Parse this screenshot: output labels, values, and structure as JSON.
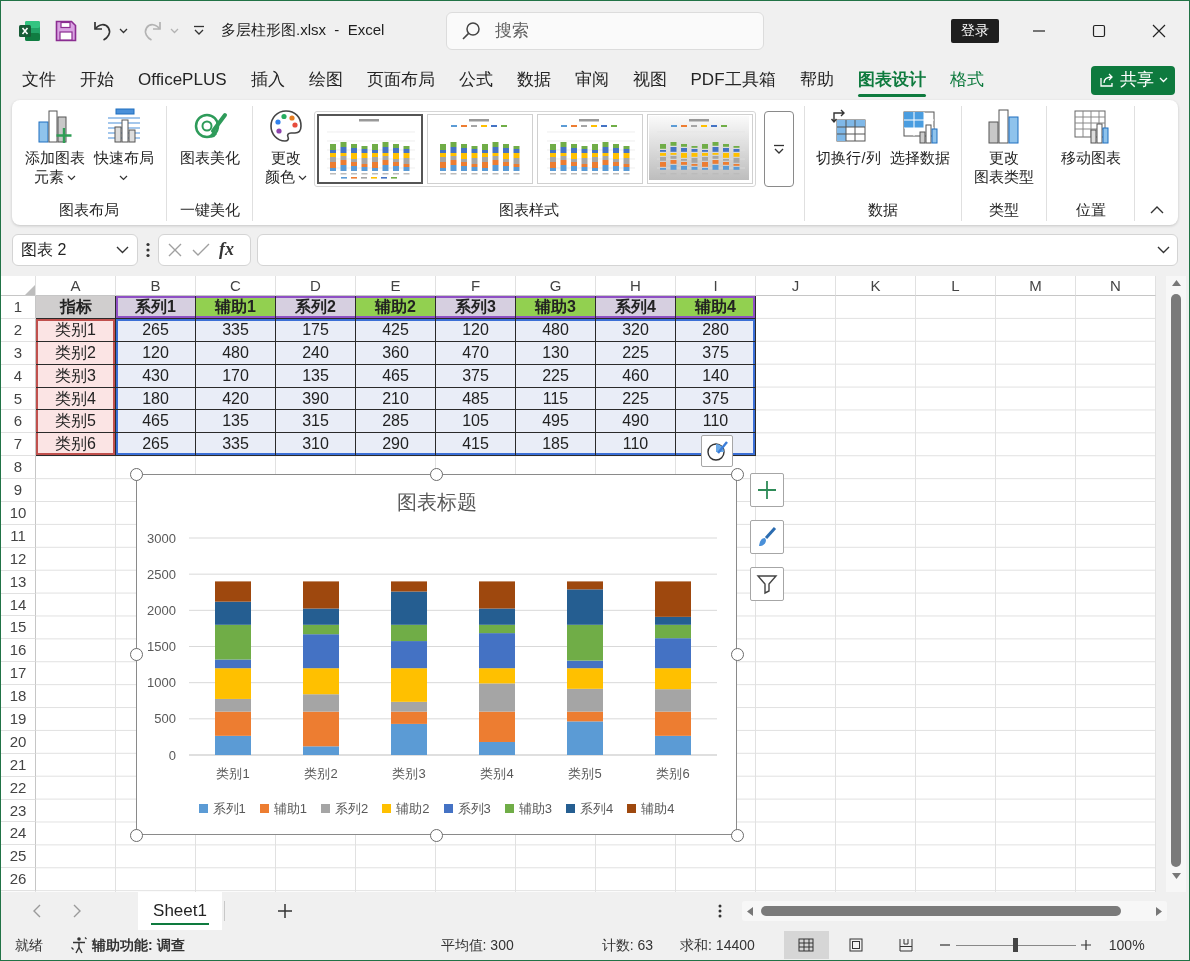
{
  "window": {
    "title": "多层柱形图.xlsx  -  Excel",
    "search_placeholder": "搜索",
    "sign_in": "登录"
  },
  "quick_access": [
    {
      "kind": "save",
      "disabled": false
    },
    {
      "kind": "undo",
      "disabled": false
    },
    {
      "kind": "redo",
      "disabled": true
    }
  ],
  "ribbon_tabs": [
    {
      "label": "文件",
      "selected": false,
      "contextual": false
    },
    {
      "label": "开始",
      "selected": false,
      "contextual": false
    },
    {
      "label": "OfficePLUS",
      "selected": false,
      "contextual": false
    },
    {
      "label": "插入",
      "selected": false,
      "contextual": false
    },
    {
      "label": "绘图",
      "selected": false,
      "contextual": false
    },
    {
      "label": "页面布局",
      "selected": false,
      "contextual": false
    },
    {
      "label": "公式",
      "selected": false,
      "contextual": false
    },
    {
      "label": "数据",
      "selected": false,
      "contextual": false
    },
    {
      "label": "审阅",
      "selected": false,
      "contextual": false
    },
    {
      "label": "视图",
      "selected": false,
      "contextual": false
    },
    {
      "label": "PDF工具箱",
      "selected": false,
      "contextual": false
    },
    {
      "label": "帮助",
      "selected": false,
      "contextual": false
    },
    {
      "label": "图表设计",
      "selected": true,
      "contextual": true
    },
    {
      "label": "格式",
      "selected": false,
      "contextual": true
    }
  ],
  "share_button": "共享",
  "ribbon_groups": [
    {
      "label": "图表布局",
      "buttons": [
        {
          "lines": [
            "添加图表",
            "元素"
          ],
          "dropdown": true
        },
        {
          "lines": [
            "快速布局"
          ],
          "dropdown": true
        }
      ]
    },
    {
      "label": "一键美化",
      "buttons": [
        {
          "lines": [
            "图表美化"
          ],
          "dropdown": false
        }
      ]
    },
    {
      "label": "图表样式",
      "buttons": [
        {
          "lines": [
            "更改",
            "颜色"
          ],
          "dropdown": true
        }
      ],
      "gallery": [
        {
          "selected": true
        },
        {
          "selected": false
        },
        {
          "selected": false
        },
        {
          "selected": false
        }
      ]
    },
    {
      "label": "数据",
      "buttons": [
        {
          "lines": [
            "切换行/列"
          ],
          "dropdown": false
        },
        {
          "lines": [
            "选择数据"
          ],
          "dropdown": false
        }
      ]
    },
    {
      "label": "类型",
      "buttons": [
        {
          "lines": [
            "更改",
            "图表类型"
          ],
          "dropdown": false
        }
      ]
    },
    {
      "label": "位置",
      "buttons": [
        {
          "lines": [
            "移动图表"
          ],
          "dropdown": false
        }
      ]
    }
  ],
  "formula_bar": {
    "name_box": "图表 2",
    "function_label": "fx"
  },
  "sheet": {
    "columns": [
      "A",
      "B",
      "C",
      "D",
      "E",
      "F",
      "G",
      "H",
      "I",
      "J",
      "K",
      "L",
      "M",
      "N"
    ],
    "row_numbers": [
      "1",
      "2",
      "3",
      "4",
      "5",
      "6",
      "7",
      "8",
      "9",
      "10",
      "11",
      "12",
      "13",
      "14",
      "15",
      "16",
      "17",
      "18",
      "19",
      "20",
      "21",
      "22",
      "23",
      "24",
      "25",
      "26"
    ],
    "cells": [
      [
        {
          "text": "指标",
          "color": "#d0cece"
        },
        {
          "text": "系列1",
          "color": "#d6cfe0"
        },
        {
          "text": "辅助1",
          "color": "#92d050"
        },
        {
          "text": "系列2",
          "color": "#d6cfe0"
        },
        {
          "text": "辅助2",
          "color": "#92d050"
        },
        {
          "text": "系列3",
          "color": "#d6cfe0"
        },
        {
          "text": "辅助3",
          "color": "#92d050"
        },
        {
          "text": "系列4",
          "color": "#d6cfe0"
        },
        {
          "text": "辅助4",
          "color": "#92d050"
        }
      ],
      [
        "类别1",
        "265",
        "335",
        "175",
        "425",
        "120",
        "480",
        "320",
        "280"
      ],
      [
        "类别2",
        "120",
        "480",
        "240",
        "360",
        "470",
        "130",
        "225",
        "375"
      ],
      [
        "类别3",
        "430",
        "170",
        "135",
        "465",
        "375",
        "225",
        "460",
        "140"
      ],
      [
        "类别4",
        "180",
        "420",
        "390",
        "210",
        "485",
        "115",
        "225",
        "375"
      ],
      [
        "类别5",
        "465",
        "135",
        "315",
        "285",
        "105",
        "495",
        "490",
        "110"
      ],
      [
        "类别6",
        "265",
        "335",
        "310",
        "290",
        "415",
        "185",
        "110"
      ]
    ]
  },
  "chart": {
    "selected": true,
    "chart_data": {
      "type": "bar",
      "title": "图表标题",
      "stacked": true,
      "grid": true,
      "legend": "bottom",
      "categories": [
        "类别1",
        "类别2",
        "类别3",
        "类别4",
        "类别5",
        "类别6"
      ],
      "series": [
        {
          "name": "系列1",
          "color": "#5b9bd5",
          "values": [
            265,
            120,
            430,
            180,
            465,
            265
          ]
        },
        {
          "name": "辅助1",
          "color": "#ed7d31",
          "values": [
            335,
            480,
            170,
            420,
            135,
            335
          ]
        },
        {
          "name": "系列2",
          "color": "#a5a5a5",
          "values": [
            175,
            240,
            135,
            390,
            315,
            310
          ]
        },
        {
          "name": "辅助2",
          "color": "#ffc000",
          "values": [
            425,
            360,
            465,
            210,
            285,
            290
          ]
        },
        {
          "name": "系列3",
          "color": "#4472c4",
          "values": [
            120,
            470,
            375,
            485,
            105,
            415
          ]
        },
        {
          "name": "辅助3",
          "color": "#70ad47",
          "values": [
            480,
            130,
            225,
            115,
            495,
            185
          ]
        },
        {
          "name": "系列4",
          "color": "#255e91",
          "values": [
            320,
            225,
            460,
            225,
            490,
            110
          ]
        },
        {
          "name": "辅助4",
          "color": "#9e480e",
          "values": [
            280,
            375,
            140,
            375,
            110,
            490
          ]
        }
      ],
      "ylim": [
        0,
        3000
      ],
      "yticks": [
        0,
        500,
        1000,
        1500,
        2000,
        2500,
        3000
      ]
    }
  },
  "sheet_tabs": [
    {
      "label": "Sheet1",
      "selected": true
    }
  ],
  "status_bar": {
    "mode": "就绪",
    "accessibility": "辅助功能: 调查",
    "average": "平均值: 300",
    "count": "计数: 63",
    "sum": "求和: 14400",
    "views": [
      {
        "selected": true
      },
      {
        "selected": false
      },
      {
        "selected": false
      }
    ],
    "zoom": {
      "level": 0.5,
      "reading": "100%"
    }
  }
}
